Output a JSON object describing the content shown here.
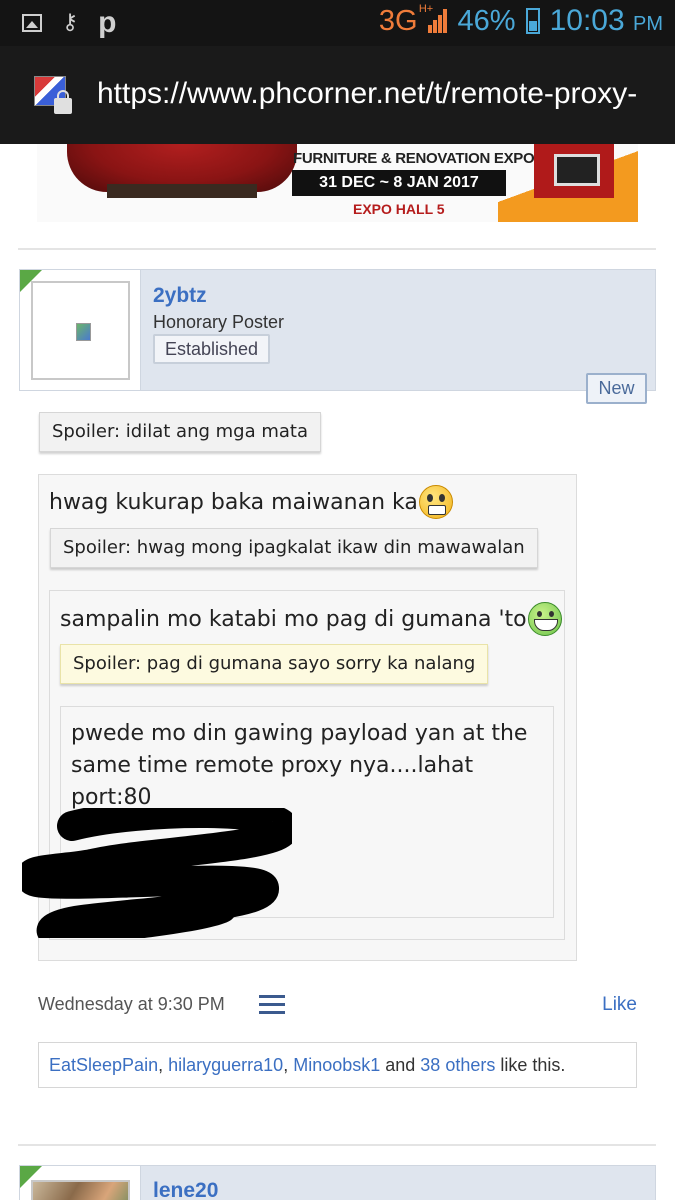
{
  "status_bar": {
    "network": "3G",
    "network_sup": "H+",
    "battery_percent": "46%",
    "time": "10:03",
    "ampm": "PM",
    "icons": [
      "image-icon",
      "key-icon",
      "p-icon",
      "signal-icon",
      "battery-icon"
    ]
  },
  "browser": {
    "url": "https://www.phcorner.net/t/remote-proxy-"
  },
  "banner": {
    "line1": "FURNITURE & RENOVATION EXPO",
    "line2": "31 DEC ~ 8 JAN 2017",
    "line3": "EXPO HALL 5"
  },
  "post": {
    "username": "2ybtz",
    "user_title": "Honorary Poster",
    "user_badge": "Established",
    "new_label": "New",
    "spoiler_outer": "Spoiler: idilat ang mga mata",
    "quote1_text": "hwag kukurap baka maiwanan ka",
    "spoiler1": "Spoiler: hwag mong ipagkalat ikaw din mawawalan",
    "quote2_text": "sampalin mo katabi mo pag di gumana 'to",
    "spoiler2": "Spoiler: pag di gumana sayo sorry ka nalang",
    "payload_text": "pwede mo din gawing payload yan at the same time remote proxy nya....lahat port:80",
    "timestamp": "Wednesday at 9:30 PM",
    "like_label": "Like",
    "likes": {
      "user1": "EatSleepPain",
      "sep1": ", ",
      "user2": "hilaryguerra10",
      "sep2": ", ",
      "user3": "Minoobsk1",
      "and": " and ",
      "others": "38 others",
      "suffix": " like this."
    }
  },
  "next_post": {
    "username": "lene20"
  },
  "colors": {
    "link": "#3b6fc2",
    "status_accent": "#4aa8d8",
    "network_accent": "#f07c3a",
    "header_bg": "#dfe5ee"
  }
}
